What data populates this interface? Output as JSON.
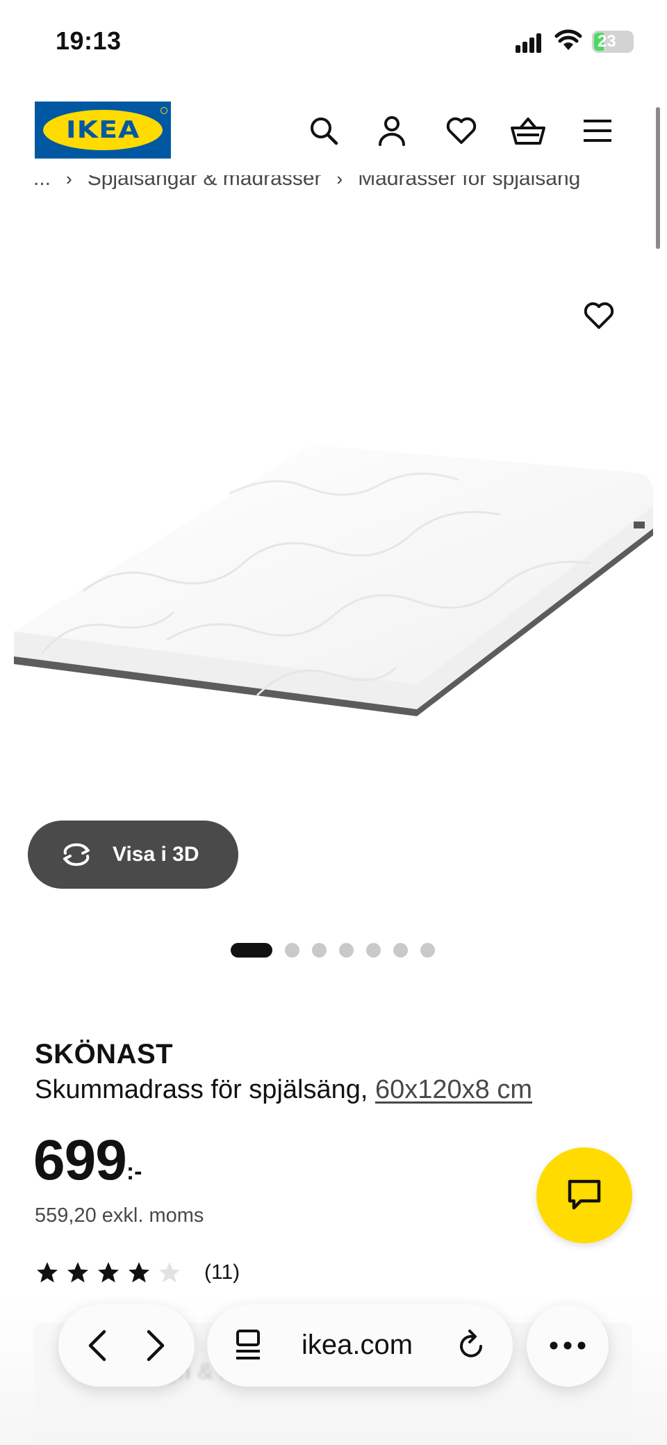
{
  "status_bar": {
    "time": "19:13",
    "battery": "23"
  },
  "header": {
    "logo_text": "IKEA",
    "icons": [
      "search-icon",
      "account-icon",
      "favorites-icon",
      "cart-icon",
      "menu-icon"
    ]
  },
  "breadcrumb": {
    "items": [
      "...",
      "Spjälsängar & madrasser",
      "Madrasser för spjälsäng"
    ]
  },
  "gallery": {
    "view3d_label": "Visa i 3D",
    "dot_count": 7,
    "active_index": 0
  },
  "product": {
    "name": "SKÖNAST",
    "description": "Skummadrass för spjälsäng,",
    "size": "60x120x8 cm",
    "price": "699",
    "price_suffix": ":-",
    "price_ex_vat": "559,20 exkl. moms",
    "rating": 4,
    "rating_max": 5,
    "review_count": "(11)"
  },
  "bottom_card": {
    "label": "Design & köp"
  },
  "browser": {
    "url": "ikea.com"
  },
  "colors": {
    "ikea_blue": "#0058a3",
    "ikea_yellow": "#ffdb00",
    "pill_dark": "#4a4a4a"
  }
}
